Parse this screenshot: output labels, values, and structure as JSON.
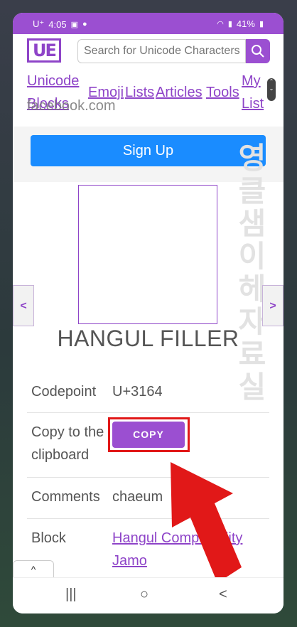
{
  "status_bar": {
    "carrier": "U⁺",
    "time": "4:05",
    "battery": "41%"
  },
  "header": {
    "logo_text": "UE",
    "search_placeholder": "Search for Unicode Characters"
  },
  "nav": {
    "unicode_line1": "Unicode",
    "blocks_line2": "Blocks",
    "emoji": "Emoji",
    "lists": "Lists",
    "articles": "Articles",
    "tools": "Tools",
    "my_line1": "My",
    "list_line2": "List"
  },
  "ad": {
    "source_text": "facebook.com",
    "signup_label": "Sign Up",
    "korean_text": "영클샘이헤자료실"
  },
  "character": {
    "name": "HANGUL FILLER",
    "prev_label": "<",
    "next_label": ">"
  },
  "details": {
    "codepoint_label": "Codepoint",
    "codepoint_value": "U+3164",
    "copy_label_line1": "Copy to the",
    "copy_label_line2": "clipboard",
    "copy_button": "COPY",
    "comments_label": "Comments",
    "comments_value": "chaeum",
    "block_label": "Block",
    "block_value_line1": "Hangul Compatibility",
    "block_value_line2": "Jamo"
  },
  "annotation": {
    "highlight_color": "#e11818"
  },
  "colors": {
    "accent": "#9b4fd1",
    "signup": "#1a8cff"
  },
  "bottom": {
    "tab_icon": "^"
  },
  "android_nav": {
    "recents": "|||",
    "home": "○",
    "back": "<"
  }
}
